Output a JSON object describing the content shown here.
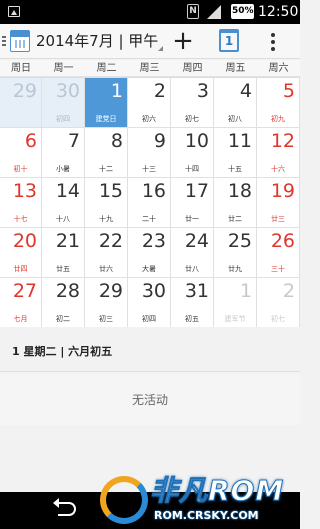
{
  "status_bar": {
    "n_badge": "N",
    "battery": "50%",
    "time": "12:50"
  },
  "action_bar": {
    "title": "2014年7月 | 甲午…",
    "add_label": "+",
    "today_label": "1"
  },
  "weekdays": [
    "周日",
    "周一",
    "周二",
    "周三",
    "周四",
    "周五",
    "周六"
  ],
  "weeks": [
    [
      {
        "day": "29",
        "lunar": "",
        "type": "prev"
      },
      {
        "day": "30",
        "lunar": "初四",
        "type": "prev"
      },
      {
        "day": "1",
        "lunar": "建党日",
        "type": "selected"
      },
      {
        "day": "2",
        "lunar": "初六",
        "type": ""
      },
      {
        "day": "3",
        "lunar": "初七",
        "type": ""
      },
      {
        "day": "4",
        "lunar": "初八",
        "type": ""
      },
      {
        "day": "5",
        "lunar": "初九",
        "type": "red"
      }
    ],
    [
      {
        "day": "6",
        "lunar": "初十",
        "type": "red"
      },
      {
        "day": "7",
        "lunar": "小暑",
        "type": ""
      },
      {
        "day": "8",
        "lunar": "十二",
        "type": ""
      },
      {
        "day": "9",
        "lunar": "十三",
        "type": ""
      },
      {
        "day": "10",
        "lunar": "十四",
        "type": ""
      },
      {
        "day": "11",
        "lunar": "十五",
        "type": ""
      },
      {
        "day": "12",
        "lunar": "十六",
        "type": "red"
      }
    ],
    [
      {
        "day": "13",
        "lunar": "十七",
        "type": "red"
      },
      {
        "day": "14",
        "lunar": "十八",
        "type": ""
      },
      {
        "day": "15",
        "lunar": "十九",
        "type": ""
      },
      {
        "day": "16",
        "lunar": "二十",
        "type": ""
      },
      {
        "day": "17",
        "lunar": "廿一",
        "type": ""
      },
      {
        "day": "18",
        "lunar": "廿二",
        "type": ""
      },
      {
        "day": "19",
        "lunar": "廿三",
        "type": "red"
      }
    ],
    [
      {
        "day": "20",
        "lunar": "廿四",
        "type": "red"
      },
      {
        "day": "21",
        "lunar": "廿五",
        "type": ""
      },
      {
        "day": "22",
        "lunar": "廿六",
        "type": ""
      },
      {
        "day": "23",
        "lunar": "大暑",
        "type": ""
      },
      {
        "day": "24",
        "lunar": "廿八",
        "type": ""
      },
      {
        "day": "25",
        "lunar": "廿九",
        "type": ""
      },
      {
        "day": "26",
        "lunar": "三十",
        "type": "red"
      }
    ],
    [
      {
        "day": "27",
        "lunar": "七月",
        "type": "red"
      },
      {
        "day": "28",
        "lunar": "初二",
        "type": ""
      },
      {
        "day": "29",
        "lunar": "初三",
        "type": ""
      },
      {
        "day": "30",
        "lunar": "初四",
        "type": ""
      },
      {
        "day": "31",
        "lunar": "初五",
        "type": ""
      },
      {
        "day": "1",
        "lunar": "建军节",
        "type": "next"
      },
      {
        "day": "2",
        "lunar": "初七",
        "type": "next"
      }
    ]
  ],
  "agenda": {
    "date_label": "1 星期二 | 六月初五",
    "empty_text": "无活动"
  },
  "watermark": {
    "brand": "非凡ROM",
    "url": "ROM.CRSKY.COM"
  },
  "colors": {
    "accent": "#4e98d8",
    "weekend": "#e0362c"
  }
}
